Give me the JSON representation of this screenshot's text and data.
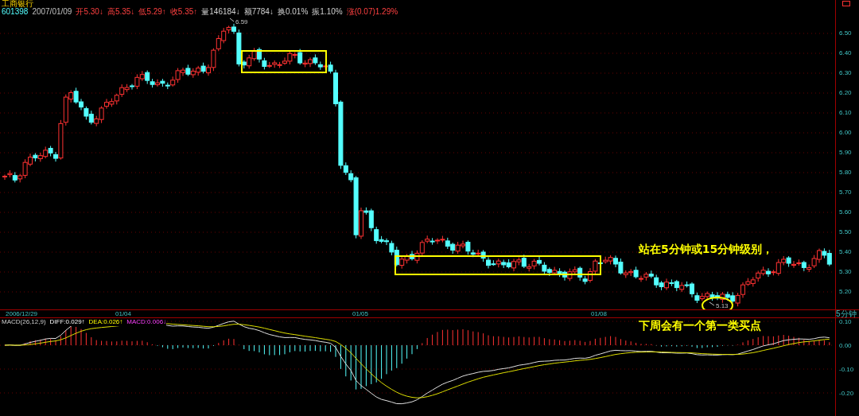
{
  "stock": {
    "name": "工商银行",
    "code": "601398",
    "date": "2007/01/09",
    "fields": [
      {
        "text": "开5.30↓",
        "kind": "price"
      },
      {
        "text": "高5.35↓",
        "kind": "price"
      },
      {
        "text": "低5.29↑",
        "kind": "price"
      },
      {
        "text": "收5.35↑",
        "kind": "price"
      },
      {
        "text": "量146184↓",
        "kind": "volume"
      },
      {
        "text": "额7784↓",
        "kind": "volume"
      },
      {
        "text": "换0.01%",
        "kind": "volume"
      },
      {
        "text": "振1.10%",
        "kind": "volume"
      },
      {
        "text": "涨(0.07)1.29%",
        "kind": "price"
      }
    ]
  },
  "price_axis": [
    "6.50",
    "6.40",
    "6.30",
    "6.20",
    "6.10",
    "6.00",
    "5.90",
    "5.80",
    "5.70",
    "5.60",
    "5.50",
    "5.40",
    "5.30",
    "5.20"
  ],
  "chart_labels": [
    {
      "text": "6.59",
      "kind": "high"
    },
    {
      "text": "5.13",
      "kind": "low"
    }
  ],
  "time_axis": {
    "dates": [
      "2006/12/29",
      "01/04",
      "01/05",
      "01/08"
    ],
    "period": "5分钟"
  },
  "macd": {
    "label": "MACD(26,12,9)",
    "diff": "DIFF:0.029↑",
    "dea": "DEA:0.026↑",
    "macd": "MACD:0.006↓",
    "axis": [
      "0.10",
      "0.00",
      "-0.10",
      "-0.20"
    ]
  },
  "annotations": [
    "站在5分钟或15分钟级别，",
    "下周会有一个第一类买点"
  ]
}
